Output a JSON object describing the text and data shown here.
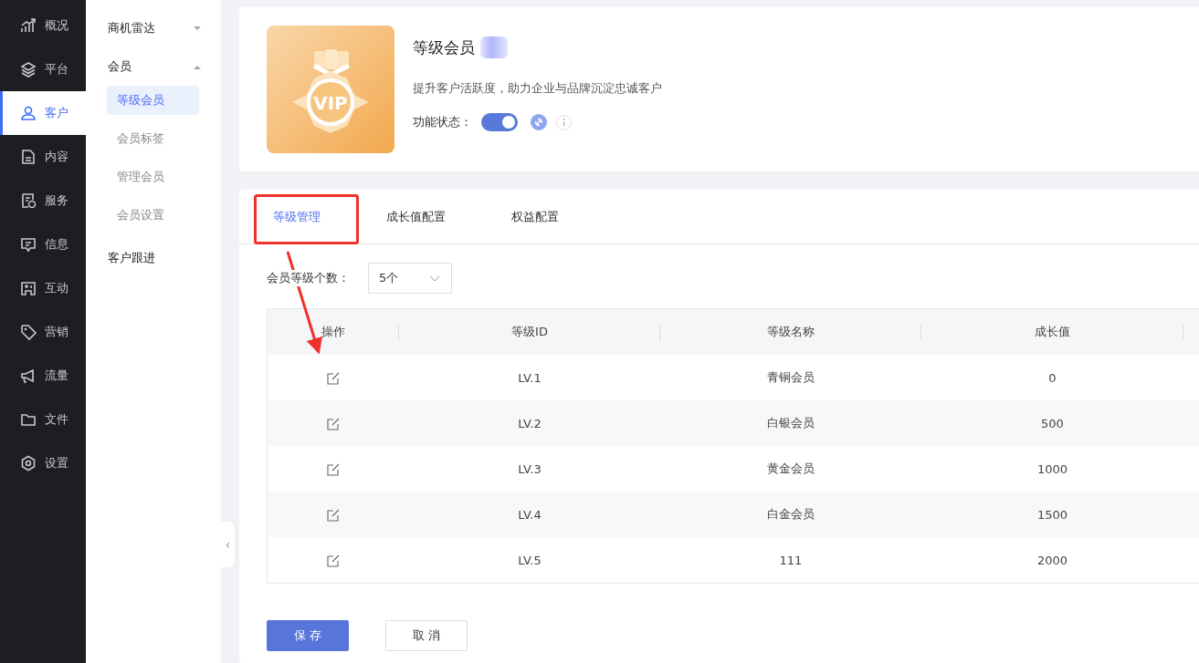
{
  "nav": [
    {
      "label": "概况",
      "selected": false
    },
    {
      "label": "平台",
      "selected": false
    },
    {
      "label": "客户",
      "selected": true
    },
    {
      "label": "内容",
      "selected": false
    },
    {
      "label": "服务",
      "selected": false
    },
    {
      "label": "信息",
      "selected": false
    },
    {
      "label": "互动",
      "selected": false
    },
    {
      "label": "营销",
      "selected": false
    },
    {
      "label": "流量",
      "selected": false
    },
    {
      "label": "文件",
      "selected": false
    },
    {
      "label": "设置",
      "selected": false
    }
  ],
  "submenu": [
    {
      "label": "商机雷达",
      "expanded": false
    },
    {
      "label": "会员",
      "expanded": true,
      "children": [
        {
          "label": "等级会员",
          "selected": true
        },
        {
          "label": "会员标签",
          "selected": false
        },
        {
          "label": "管理会员",
          "selected": false
        },
        {
          "label": "会员设置",
          "selected": false
        }
      ]
    },
    {
      "label": "客户跟进",
      "expanded": false
    }
  ],
  "header": {
    "badge_text": "VIP",
    "title": "等级会员",
    "description": "提升客户活跃度，助力企业与品牌沉淀忠诚客户",
    "status_label": "功能状态：",
    "status_on": true
  },
  "tabs": [
    {
      "label": "等级管理",
      "selected": true
    },
    {
      "label": "成长值配置",
      "selected": false
    },
    {
      "label": "权益配置",
      "selected": false
    }
  ],
  "level_count": {
    "label": "会员等级个数：",
    "value": "5个"
  },
  "table": {
    "columns": [
      "操作",
      "等级ID",
      "等级名称",
      "成长值"
    ],
    "rows": [
      {
        "id": "LV.1",
        "name": "青铜会员",
        "growth": "0"
      },
      {
        "id": "LV.2",
        "name": "白银会员",
        "growth": "500"
      },
      {
        "id": "LV.3",
        "name": "黄金会员",
        "growth": "1000"
      },
      {
        "id": "LV.4",
        "name": "白金会员",
        "growth": "1500"
      },
      {
        "id": "LV.5",
        "name": "111",
        "growth": "2000"
      }
    ]
  },
  "buttons": [
    {
      "label": "保 存",
      "kind": "primary"
    },
    {
      "label": "取 消",
      "kind": "default"
    }
  ],
  "collapse_handle": "‹"
}
